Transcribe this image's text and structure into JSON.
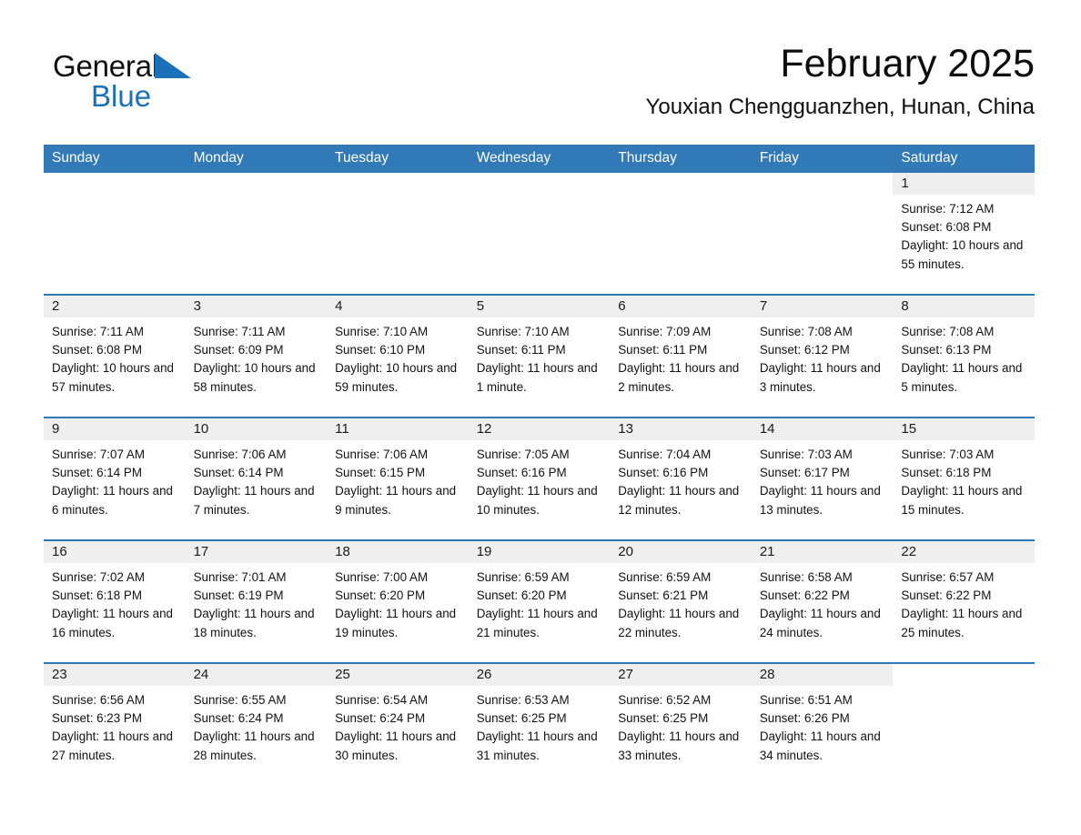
{
  "brand": {
    "name_part1": "General",
    "name_part2": "Blue",
    "triangle_icon": "triangle-icon",
    "accent_color": "#1b71b8"
  },
  "header": {
    "month_title": "February 2025",
    "location": "Youxian Chengguanzhen, Hunan, China"
  },
  "calendar": {
    "header_bg_color": "#3179b7",
    "daynum_bg_color": "#efefef",
    "row_divider_color": "#2f78b6",
    "weekday_headers": [
      "Sunday",
      "Monday",
      "Tuesday",
      "Wednesday",
      "Thursday",
      "Friday",
      "Saturday"
    ],
    "labels": {
      "sunrise": "Sunrise:",
      "sunset": "Sunset:",
      "daylight": "Daylight:"
    },
    "weeks": [
      [
        {
          "day": "",
          "blank": true
        },
        {
          "day": "",
          "blank": true
        },
        {
          "day": "",
          "blank": true
        },
        {
          "day": "",
          "blank": true
        },
        {
          "day": "",
          "blank": true
        },
        {
          "day": "",
          "blank": true
        },
        {
          "day": "1",
          "sunrise": "Sunrise: 7:12 AM",
          "sunset": "Sunset: 6:08 PM",
          "daylight": "Daylight: 10 hours and 55 minutes."
        }
      ],
      [
        {
          "day": "2",
          "sunrise": "Sunrise: 7:11 AM",
          "sunset": "Sunset: 6:08 PM",
          "daylight": "Daylight: 10 hours and 57 minutes."
        },
        {
          "day": "3",
          "sunrise": "Sunrise: 7:11 AM",
          "sunset": "Sunset: 6:09 PM",
          "daylight": "Daylight: 10 hours and 58 minutes."
        },
        {
          "day": "4",
          "sunrise": "Sunrise: 7:10 AM",
          "sunset": "Sunset: 6:10 PM",
          "daylight": "Daylight: 10 hours and 59 minutes."
        },
        {
          "day": "5",
          "sunrise": "Sunrise: 7:10 AM",
          "sunset": "Sunset: 6:11 PM",
          "daylight": "Daylight: 11 hours and 1 minute."
        },
        {
          "day": "6",
          "sunrise": "Sunrise: 7:09 AM",
          "sunset": "Sunset: 6:11 PM",
          "daylight": "Daylight: 11 hours and 2 minutes."
        },
        {
          "day": "7",
          "sunrise": "Sunrise: 7:08 AM",
          "sunset": "Sunset: 6:12 PM",
          "daylight": "Daylight: 11 hours and 3 minutes."
        },
        {
          "day": "8",
          "sunrise": "Sunrise: 7:08 AM",
          "sunset": "Sunset: 6:13 PM",
          "daylight": "Daylight: 11 hours and 5 minutes."
        }
      ],
      [
        {
          "day": "9",
          "sunrise": "Sunrise: 7:07 AM",
          "sunset": "Sunset: 6:14 PM",
          "daylight": "Daylight: 11 hours and 6 minutes."
        },
        {
          "day": "10",
          "sunrise": "Sunrise: 7:06 AM",
          "sunset": "Sunset: 6:14 PM",
          "daylight": "Daylight: 11 hours and 7 minutes."
        },
        {
          "day": "11",
          "sunrise": "Sunrise: 7:06 AM",
          "sunset": "Sunset: 6:15 PM",
          "daylight": "Daylight: 11 hours and 9 minutes."
        },
        {
          "day": "12",
          "sunrise": "Sunrise: 7:05 AM",
          "sunset": "Sunset: 6:16 PM",
          "daylight": "Daylight: 11 hours and 10 minutes."
        },
        {
          "day": "13",
          "sunrise": "Sunrise: 7:04 AM",
          "sunset": "Sunset: 6:16 PM",
          "daylight": "Daylight: 11 hours and 12 minutes."
        },
        {
          "day": "14",
          "sunrise": "Sunrise: 7:03 AM",
          "sunset": "Sunset: 6:17 PM",
          "daylight": "Daylight: 11 hours and 13 minutes."
        },
        {
          "day": "15",
          "sunrise": "Sunrise: 7:03 AM",
          "sunset": "Sunset: 6:18 PM",
          "daylight": "Daylight: 11 hours and 15 minutes."
        }
      ],
      [
        {
          "day": "16",
          "sunrise": "Sunrise: 7:02 AM",
          "sunset": "Sunset: 6:18 PM",
          "daylight": "Daylight: 11 hours and 16 minutes."
        },
        {
          "day": "17",
          "sunrise": "Sunrise: 7:01 AM",
          "sunset": "Sunset: 6:19 PM",
          "daylight": "Daylight: 11 hours and 18 minutes."
        },
        {
          "day": "18",
          "sunrise": "Sunrise: 7:00 AM",
          "sunset": "Sunset: 6:20 PM",
          "daylight": "Daylight: 11 hours and 19 minutes."
        },
        {
          "day": "19",
          "sunrise": "Sunrise: 6:59 AM",
          "sunset": "Sunset: 6:20 PM",
          "daylight": "Daylight: 11 hours and 21 minutes."
        },
        {
          "day": "20",
          "sunrise": "Sunrise: 6:59 AM",
          "sunset": "Sunset: 6:21 PM",
          "daylight": "Daylight: 11 hours and 22 minutes."
        },
        {
          "day": "21",
          "sunrise": "Sunrise: 6:58 AM",
          "sunset": "Sunset: 6:22 PM",
          "daylight": "Daylight: 11 hours and 24 minutes."
        },
        {
          "day": "22",
          "sunrise": "Sunrise: 6:57 AM",
          "sunset": "Sunset: 6:22 PM",
          "daylight": "Daylight: 11 hours and 25 minutes."
        }
      ],
      [
        {
          "day": "23",
          "sunrise": "Sunrise: 6:56 AM",
          "sunset": "Sunset: 6:23 PM",
          "daylight": "Daylight: 11 hours and 27 minutes."
        },
        {
          "day": "24",
          "sunrise": "Sunrise: 6:55 AM",
          "sunset": "Sunset: 6:24 PM",
          "daylight": "Daylight: 11 hours and 28 minutes."
        },
        {
          "day": "25",
          "sunrise": "Sunrise: 6:54 AM",
          "sunset": "Sunset: 6:24 PM",
          "daylight": "Daylight: 11 hours and 30 minutes."
        },
        {
          "day": "26",
          "sunrise": "Sunrise: 6:53 AM",
          "sunset": "Sunset: 6:25 PM",
          "daylight": "Daylight: 11 hours and 31 minutes."
        },
        {
          "day": "27",
          "sunrise": "Sunrise: 6:52 AM",
          "sunset": "Sunset: 6:25 PM",
          "daylight": "Daylight: 11 hours and 33 minutes."
        },
        {
          "day": "28",
          "sunrise": "Sunrise: 6:51 AM",
          "sunset": "Sunset: 6:26 PM",
          "daylight": "Daylight: 11 hours and 34 minutes."
        },
        {
          "day": "",
          "blank": true
        }
      ]
    ]
  }
}
